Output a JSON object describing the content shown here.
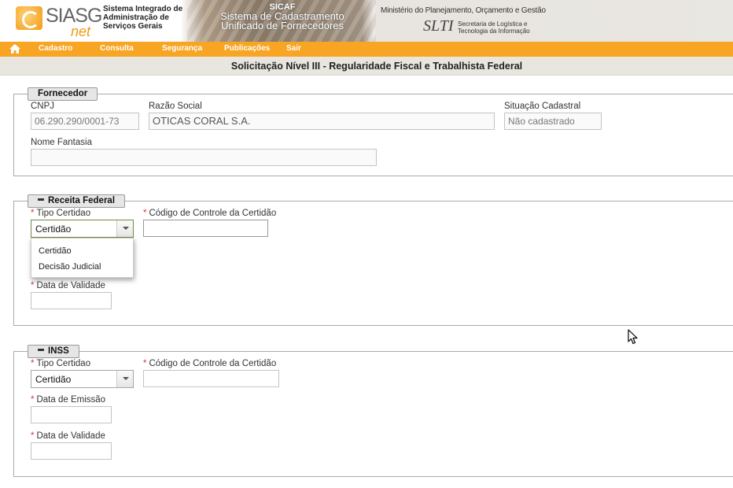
{
  "header": {
    "logo_main": "SIASG",
    "logo_sub": "net",
    "system_name": [
      "Sistema Integrado de",
      "Administração de",
      "Serviços Gerais"
    ],
    "sicaf_title": "SICAF",
    "sicaf_subtitle_1": "Sistema de Cadastramento",
    "sicaf_subtitle_2": "Unificado de Fornecedores",
    "ministry": "Ministério do Planejamento, Orçamento e Gestão",
    "slti_logo": "SLTI",
    "slti_text_1": "Secretaria de Logística e",
    "slti_text_2": "Tecnologia da Informação"
  },
  "menu": {
    "items": [
      "Cadastro",
      "Consulta",
      "Segurança",
      "Publicações",
      "Sair"
    ],
    "home_icon": "home-icon"
  },
  "page_title": "Solicitação Nível III - Regularidade Fiscal e Trabalhista Federal",
  "fornecedor": {
    "legend": "Fornecedor",
    "cnpj_label": "CNPJ",
    "cnpj_value": "06.290.290/0001-73",
    "razao_label": "Razão Social",
    "razao_value": "OTICAS CORAL S.A.",
    "situacao_label": "Situação Cadastral",
    "situacao_value": "Não cadastrado",
    "fantasia_label": "Nome Fantasia",
    "fantasia_value": ""
  },
  "receita": {
    "legend": "Receita Federal",
    "tipo_label": "Tipo Certidao",
    "tipo_value": "Certidão",
    "codigo_label": "Código de Controle da Certidão",
    "codigo_value": "",
    "validade_label": "Data de Validade",
    "validade_value": "",
    "dropdown_options": [
      "Certidão",
      "Decisão Judicial"
    ]
  },
  "inss": {
    "legend": "INSS",
    "tipo_label": "Tipo Certidao",
    "tipo_value": "Certidão",
    "codigo_label": "Código de Controle da Certidão",
    "codigo_value": "",
    "emissao_label": "Data de Emissão",
    "emissao_value": "",
    "validade_label": "Data de Validade",
    "validade_value": ""
  },
  "required_marker": "*",
  "colors": {
    "menu_bar": "#f7a522",
    "title_bar": "#e8e6de",
    "required": "#dd3333",
    "active_select_border": "#6f8c42"
  }
}
